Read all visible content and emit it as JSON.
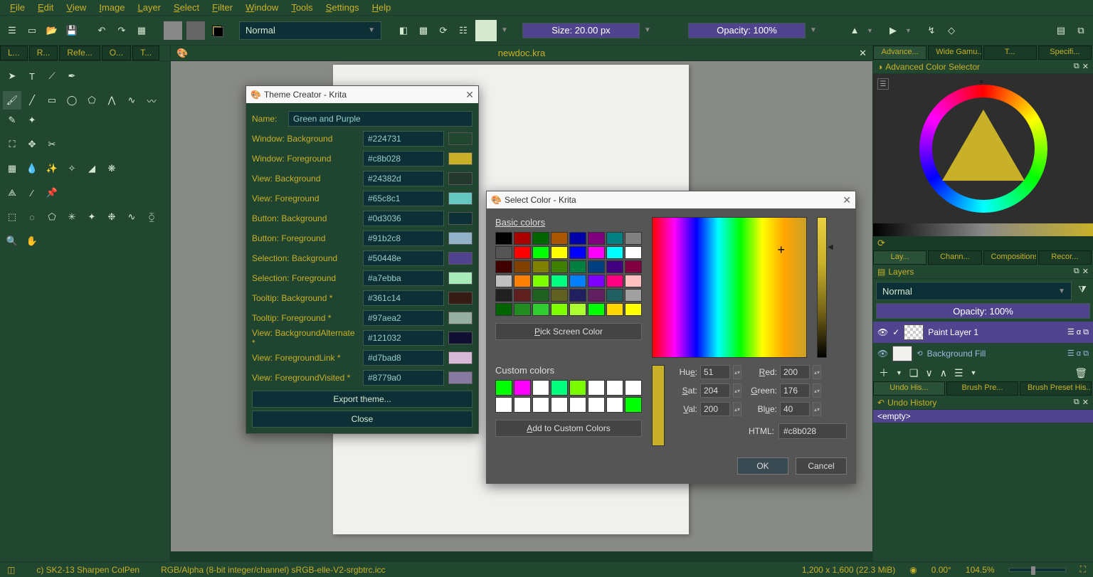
{
  "menubar": [
    "File",
    "Edit",
    "View",
    "Image",
    "Layer",
    "Select",
    "Filter",
    "Window",
    "Tools",
    "Settings",
    "Help"
  ],
  "toolbar": {
    "blend_mode": "Normal",
    "size_label": "Size: 20.00 px",
    "opacity_label": "Opacity: 100%"
  },
  "left_tabs": [
    "L...",
    "R...",
    "Refe...",
    "O...",
    "T..."
  ],
  "doc_title": "newdoc.kra",
  "right_top_tabs": [
    "Advance...",
    "Wide Gamu...",
    "T...",
    "Specifi..."
  ],
  "color_panel_title": "Advanced Color Selector",
  "layer_tabs": [
    "Lay...",
    "Chann...",
    "Compositions",
    "Recor..."
  ],
  "layers_panel": {
    "title": "Layers",
    "blend": "Normal",
    "opacity": "Opacity:  100%",
    "items": [
      {
        "name": "Paint Layer 1",
        "active": true
      },
      {
        "name": "Background Fill",
        "active": false
      }
    ]
  },
  "bottom_tabs": [
    "Undo His...",
    "Brush Pre...",
    "Brush Preset His..."
  ],
  "undo_panel": {
    "title": "Undo History",
    "empty": "<empty>"
  },
  "status": {
    "brush": "c) SK2-13 Sharpen ColPen",
    "profile": "RGB/Alpha (8-bit integer/channel)  sRGB-elle-V2-srgbtrc.icc",
    "dims": "1,200 x 1,600 (22.3 MiB)",
    "angle": "0.00°",
    "zoom": "104.5%"
  },
  "theme_dlg": {
    "title": "Theme Creator - Krita",
    "name_lbl": "Name:",
    "name_val": "Green and Purple",
    "rows": [
      {
        "lbl": "Window: Background",
        "val": "#224731",
        "col": "#224731"
      },
      {
        "lbl": "Window: Foreground",
        "val": "#c8b028",
        "col": "#c8b028"
      },
      {
        "lbl": "View: Background",
        "val": "#24382d",
        "col": "#24382d"
      },
      {
        "lbl": "View: Foreground",
        "val": "#65c8c1",
        "col": "#65c8c1"
      },
      {
        "lbl": "Button: Background",
        "val": "#0d3036",
        "col": "#0d3036"
      },
      {
        "lbl": "Button: Foreground",
        "val": "#91b2c8",
        "col": "#91b2c8"
      },
      {
        "lbl": "Selection: Background",
        "val": "#50448e",
        "col": "#50448e"
      },
      {
        "lbl": "Selection: Foreground",
        "val": "#a7ebba",
        "col": "#a7ebba"
      },
      {
        "lbl": "Tooltip: Background *",
        "val": "#361c14",
        "col": "#361c14"
      },
      {
        "lbl": "Tooltip: Foreground *",
        "val": "#97aea2",
        "col": "#97aea2"
      },
      {
        "lbl": "View: BackgroundAlternate *",
        "val": "#121032",
        "col": "#121032"
      },
      {
        "lbl": "View: ForegroundLink *",
        "val": "#d7bad8",
        "col": "#d7bad8"
      },
      {
        "lbl": "View: ForegroundVisited *",
        "val": "#8779a0",
        "col": "#8779a0"
      }
    ],
    "export": "Export theme...",
    "close": "Close"
  },
  "color_dlg": {
    "title": "Select Color - Krita",
    "basic_lbl": "Basic colors",
    "custom_lbl": "Custom colors",
    "pick_btn": "Pick Screen Color",
    "add_btn": "Add to Custom Colors",
    "basic_colors": [
      "#000000",
      "#aa0000",
      "#006400",
      "#aa5500",
      "#0000aa",
      "#800080",
      "#008080",
      "#808080",
      "#555555",
      "#ff0000",
      "#00ff00",
      "#ffff00",
      "#0000ff",
      "#ff00ff",
      "#00ffff",
      "#ffffff",
      "#400000",
      "#804000",
      "#808000",
      "#408000",
      "#008040",
      "#004080",
      "#400080",
      "#800040",
      "#c0c0c0",
      "#ff8000",
      "#80ff00",
      "#00ff80",
      "#0080ff",
      "#8000ff",
      "#ff0080",
      "#ffc0c0",
      "#202020",
      "#602020",
      "#206020",
      "#606020",
      "#202060",
      "#602060",
      "#206060",
      "#a0a0a0",
      "#006400",
      "#228b22",
      "#32cd32",
      "#7fff00",
      "#adff2f",
      "#00ff00",
      "#ffd700",
      "#ffff00"
    ],
    "basic_colors2": [
      "#00ff00",
      "#ff00ff",
      "#ffffff",
      "#00ff7f",
      "#7cfc00",
      "#ffffff",
      "#ffffff",
      "#ffffff",
      "#ffffff",
      "#ffffff",
      "#ffffff",
      "#ffffff",
      "#ffffff",
      "#ffffff",
      "#ffffff",
      "#00ff00"
    ],
    "hsv": {
      "hue": "Hue:",
      "sat": "Sat:",
      "val": "Val:",
      "h": "51",
      "s": "204",
      "v": "200"
    },
    "rgb": {
      "red": "Red:",
      "green": "Green:",
      "blue": "Blue:",
      "r": "200",
      "g": "176",
      "b": "40"
    },
    "html_lbl": "HTML:",
    "html_val": "#c8b028",
    "ok": "OK",
    "cancel": "Cancel"
  }
}
